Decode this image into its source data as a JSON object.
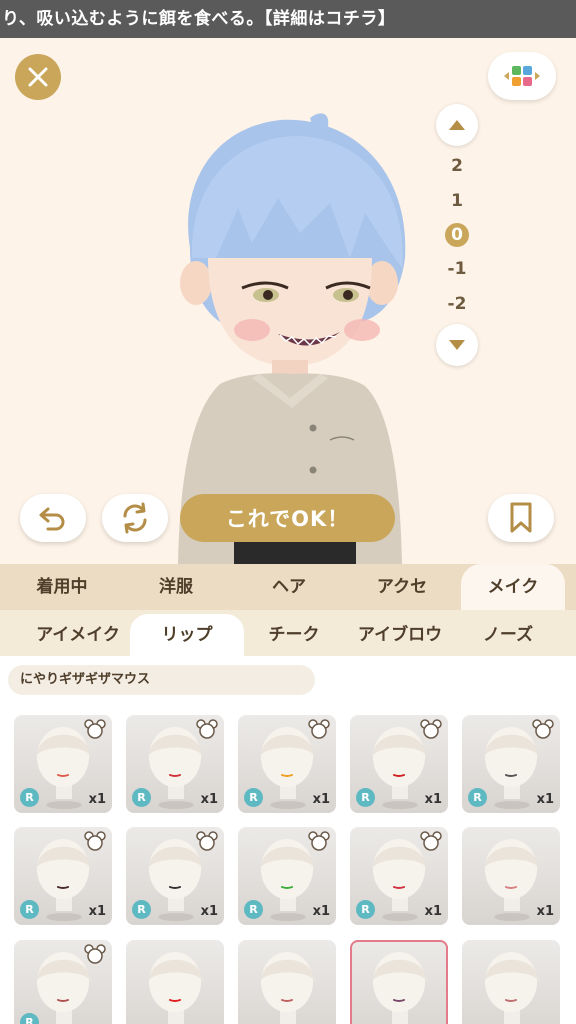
{
  "banner": {
    "text": "り、吸い込むように餌を食べる。【詳細はコチラ】"
  },
  "zoom": {
    "levels": [
      "2",
      "1",
      "0",
      "-1",
      "-2"
    ],
    "selected": "0"
  },
  "actions": {
    "ok_label": "これでOK！"
  },
  "category_tabs": [
    "着用中",
    "洋服",
    "ヘア",
    "アクセ",
    "メイク"
  ],
  "category_selected": "メイク",
  "sub_tabs": [
    "アイメイク",
    "リップ",
    "チーク",
    "アイブロウ",
    "ノーズ"
  ],
  "sub_selected": "リップ",
  "selected_item_name": "にやりギザギザマウス",
  "items": [
    {
      "rarity": "R",
      "qty": "x1",
      "bear": true,
      "lip": "#e05a4a"
    },
    {
      "rarity": "R",
      "qty": "x1",
      "bear": true,
      "lip": "#d0303a"
    },
    {
      "rarity": "R",
      "qty": "x1",
      "bear": true,
      "lip": "#f0a020"
    },
    {
      "rarity": "R",
      "qty": "x1",
      "bear": true,
      "lip": "#d02020"
    },
    {
      "rarity": "R",
      "qty": "x1",
      "bear": true,
      "lip": "#555555"
    },
    {
      "rarity": "R",
      "qty": "x1",
      "bear": true,
      "lip": "#4a2a2a"
    },
    {
      "rarity": "R",
      "qty": "x1",
      "bear": true,
      "lip": "#333333"
    },
    {
      "rarity": "R",
      "qty": "x1",
      "bear": true,
      "lip": "#3cae3c"
    },
    {
      "rarity": "R",
      "qty": "x1",
      "bear": true,
      "lip": "#d03040"
    },
    {
      "rarity": "",
      "qty": "x1",
      "bear": false,
      "lip": "#d98080"
    },
    {
      "rarity": "R",
      "qty": "",
      "bear": true,
      "lip": "#b05050"
    },
    {
      "rarity": "",
      "qty": "",
      "bear": false,
      "lip": "#e02020"
    },
    {
      "rarity": "",
      "qty": "",
      "bear": false,
      "lip": "#c06060"
    },
    {
      "rarity": "",
      "qty": "",
      "bear": false,
      "lip": "#7a4a6a",
      "selected": true
    },
    {
      "rarity": "",
      "qty": "",
      "bear": false,
      "lip": "#c07070"
    }
  ],
  "colors": {
    "gold": "#c9a65a",
    "teal_badge": "#5eb9c2",
    "hair": "#a9c4ea",
    "shirt": "#d7cdbf",
    "selected_border": "#e37b8a"
  },
  "icons": [
    "close-icon",
    "color-palette-icon",
    "chevron-up-icon",
    "chevron-down-icon",
    "undo-icon",
    "rotate-icon",
    "bookmark-icon",
    "bear-icon"
  ]
}
